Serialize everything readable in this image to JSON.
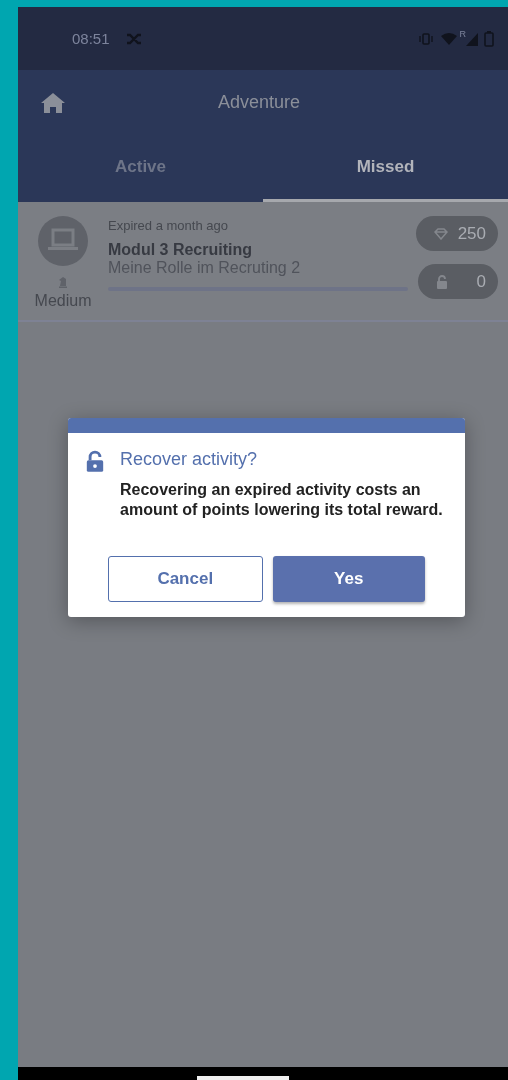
{
  "status_bar": {
    "time": "08:51",
    "roaming": "R"
  },
  "app_bar": {
    "title": "Adventure"
  },
  "tabs": [
    {
      "label": "Active",
      "selected": false
    },
    {
      "label": "Missed",
      "selected": true
    }
  ],
  "activities": [
    {
      "status": "Expired a month ago",
      "title": "Modul 3 Recruiting",
      "subtitle": "Meine Rolle im Recruting 2",
      "difficulty": "Medium",
      "level": 0,
      "points": "250",
      "cost": "0"
    }
  ],
  "dialog": {
    "title": "Recover activity?",
    "message": "Recovering an expired activity costs an amount of points lowering its total reward.",
    "buttons": [
      {
        "label": "Cancel",
        "kind": "secondary"
      },
      {
        "label": "Yes",
        "kind": "primary"
      }
    ]
  }
}
